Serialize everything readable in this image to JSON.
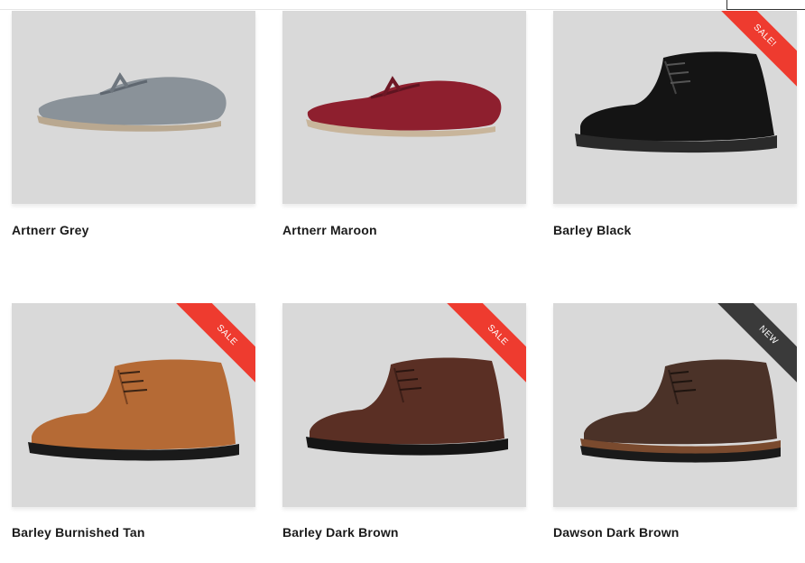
{
  "products": [
    {
      "name": "Artnerr Grey",
      "badge": "",
      "color": "#8a9299"
    },
    {
      "name": "Artnerr Maroon",
      "badge": "",
      "color": "#8e1f2e"
    },
    {
      "name": "Barley Black",
      "badge": "SALE!",
      "color": "#111111"
    },
    {
      "name": "Barley Burnished Tan",
      "badge": "SALE",
      "color": "#b56a35"
    },
    {
      "name": "Barley Dark Brown",
      "badge": "SALE",
      "color": "#5a2f24"
    },
    {
      "name": "Dawson Dark Brown",
      "badge": "NEW",
      "color": "#4b3228"
    }
  ],
  "colors": {
    "sale": "#ee3b2f",
    "new": "#3a3a3a",
    "tile_bg": "#d9d9d9"
  }
}
